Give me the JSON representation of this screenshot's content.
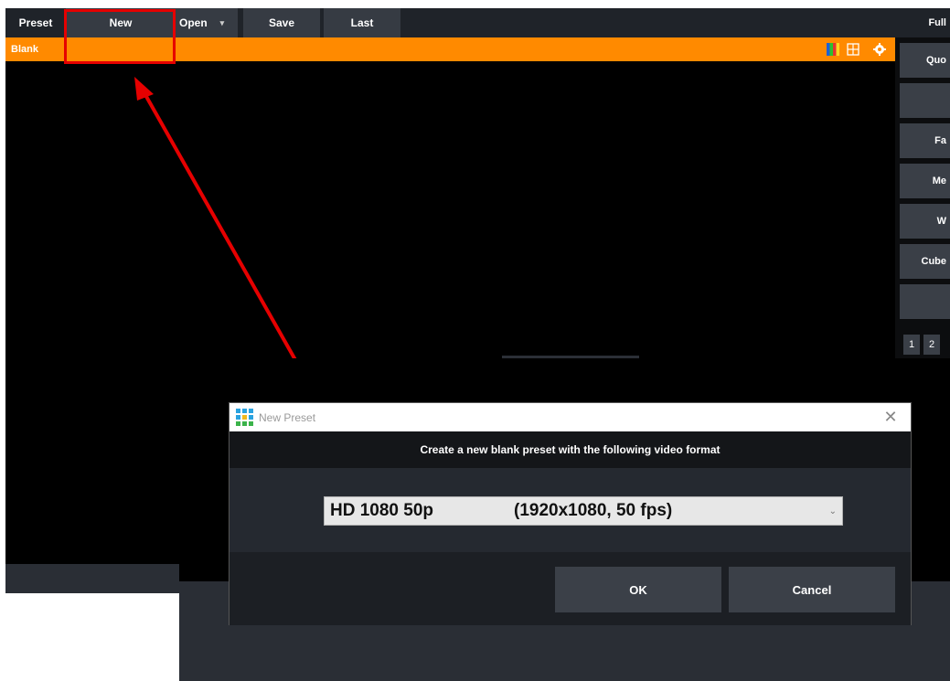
{
  "toolbar": {
    "preset_label": "Preset",
    "new_label": "New",
    "open_label": "Open",
    "open_caret": "▾",
    "save_label": "Save",
    "last_label": "Last"
  },
  "preset_bar": {
    "name": "Blank",
    "color": "#ff8a00"
  },
  "right_panel": {
    "top_label": "Full",
    "buttons": [
      "Quo",
      "",
      "Fa",
      "Me",
      "W",
      "Cube",
      ""
    ],
    "numbers": [
      "1",
      "2"
    ]
  },
  "dialog": {
    "title": "New Preset",
    "close_symbol": "✕",
    "header": "Create a new blank preset with the following video format",
    "select": {
      "format": "HD 1080 50p",
      "details": "(1920x1080, 50 fps)",
      "chevron": "⌄"
    },
    "ok_label": "OK",
    "cancel_label": "Cancel"
  },
  "annotation": {
    "color": "#e60000"
  }
}
